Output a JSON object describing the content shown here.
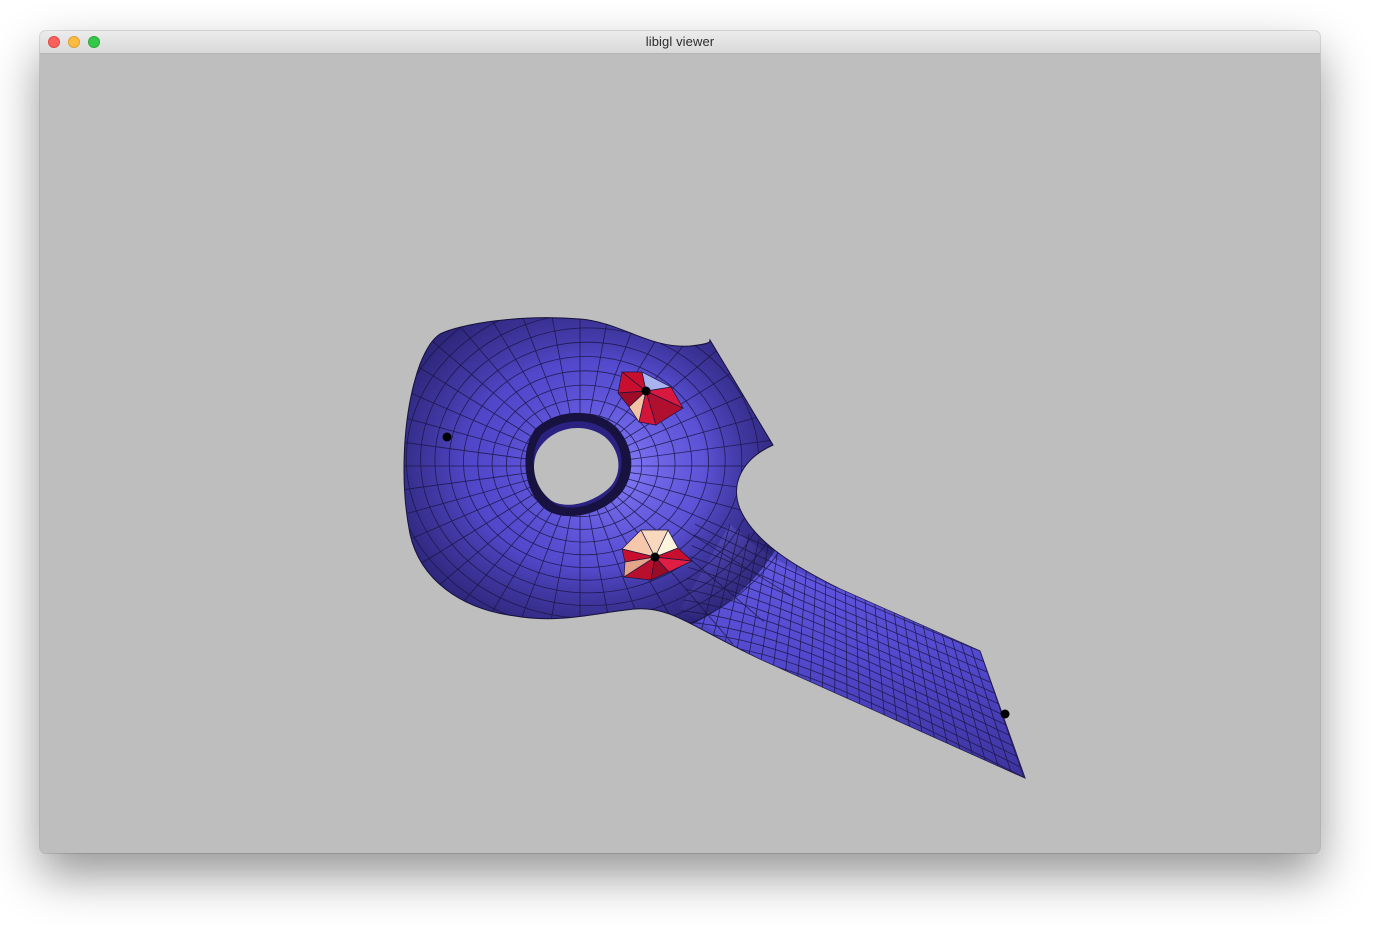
{
  "window": {
    "title": "libigl viewer",
    "controls": [
      "close-button",
      "minimize-button",
      "zoom-button"
    ]
  },
  "viewport": {
    "background_color": "#bebebe",
    "mesh": {
      "face_color": "#5046c8",
      "highlight_face_colors": [
        "#c8102e",
        "#f3c2a4",
        "#a9b3f0",
        "#fff4dc"
      ],
      "edge_color": "#1a1440",
      "constraint_point_count": 4
    }
  }
}
